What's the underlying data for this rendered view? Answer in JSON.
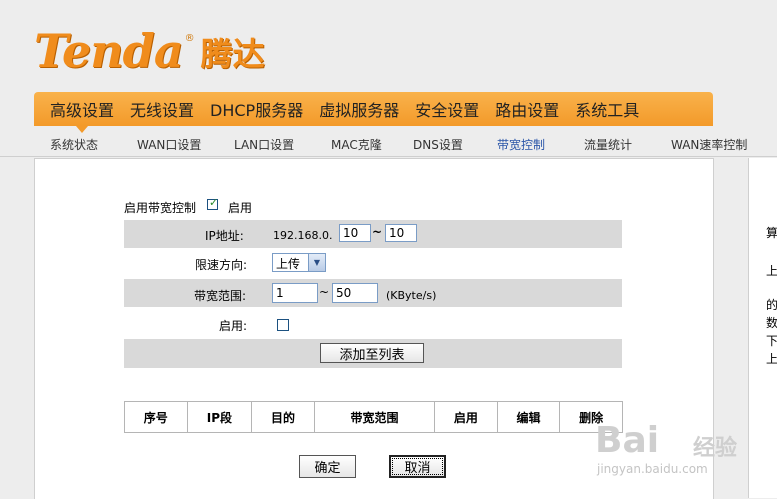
{
  "brand": {
    "name": "Tenda",
    "registered": "®",
    "cn_name": "腾达"
  },
  "main_nav": [
    "高级设置",
    "无线设置",
    "DHCP服务器",
    "虚拟服务器",
    "安全设置",
    "路由设置",
    "系统工具"
  ],
  "sub_nav": [
    "系统状态",
    "WAN口设置",
    "LAN口设置",
    "MAC克隆",
    "DNS设置",
    "带宽控制",
    "流量统计",
    "WAN速率控制"
  ],
  "active_sub_nav": "带宽控制",
  "form": {
    "enable_bw_label": "启用带宽控制",
    "enable_bw_checked": true,
    "enable_bw_text": "启用",
    "ip_label": "IP地址:",
    "ip_prefix": "192.168.0.",
    "ip_start": "10",
    "ip_sep": "~",
    "ip_end": "10",
    "direction_label": "限速方向:",
    "direction_value": "上传",
    "range_label": "带宽范围:",
    "range_min": "1",
    "range_sep": "~",
    "range_max": "50",
    "range_unit": "(KByte/s)",
    "enable_label": "启用:",
    "enable_checked": false,
    "add_button": "添加至列表"
  },
  "table": {
    "headers": [
      "序号",
      "IP段",
      "目的",
      "带宽范围",
      "启用",
      "编辑",
      "删除"
    ]
  },
  "buttons": {
    "ok": "确定",
    "cancel": "取消"
  },
  "right_panel_fragments": [
    "算",
    "上",
    "的",
    "数",
    "下",
    "上"
  ],
  "watermark": {
    "brand": "Bai",
    "jingyan": "经验",
    "url": "jingyan.baidu.com"
  },
  "colors": {
    "nav_orange": "#f39a2a",
    "brand_orange": "#f08c1c",
    "active_link": "#2a55a8",
    "row_shade": "#d9d9d9"
  }
}
